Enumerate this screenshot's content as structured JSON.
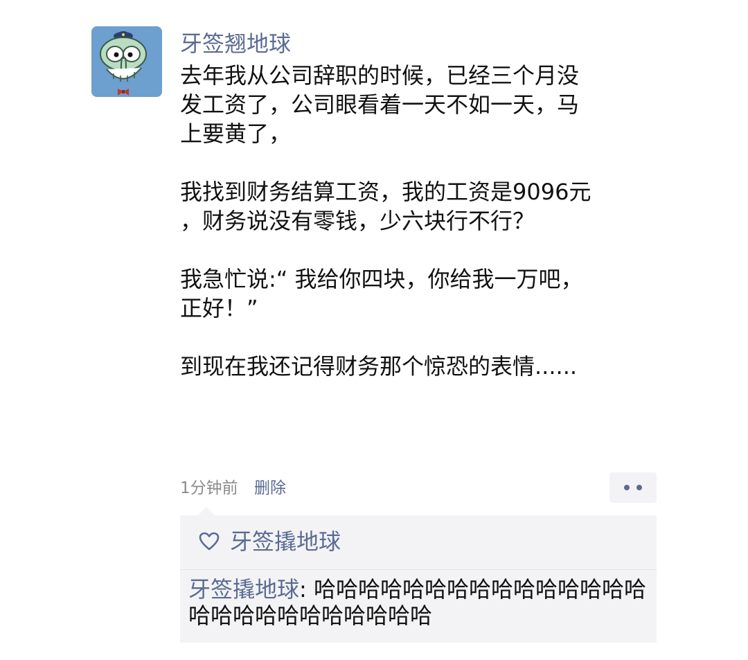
{
  "post": {
    "author": "牙签翘地球",
    "paragraphs": [
      "去年我从公司辞职的时候，已经三个月没\n发工资了，公司眼看着一天不如一天，马\n上要黄了，",
      "我找到财务结算工资，我的工资是9096元\n，财务说没有零钱，少六块行不行？",
      "我急忙说:“ 我给你四块，你给我一万吧，\n正好！”",
      "到现在我还记得财务那个惊恐的表情......"
    ],
    "time": "1分钟前",
    "delete_label": "删除"
  },
  "likes": {
    "icon": "heart-icon",
    "names": "牙签撬地球"
  },
  "comments": [
    {
      "author": "牙签撬地球",
      "separator": ": ",
      "text": "哈哈哈哈哈哈哈哈哈哈哈哈哈哈哈哈哈哈哈哈哈哈哈哈哈哈"
    }
  ],
  "colors": {
    "accent": "#5b6b92",
    "comment_bg": "#f3f3f5",
    "avatar_bg": "#6d9fcf"
  }
}
